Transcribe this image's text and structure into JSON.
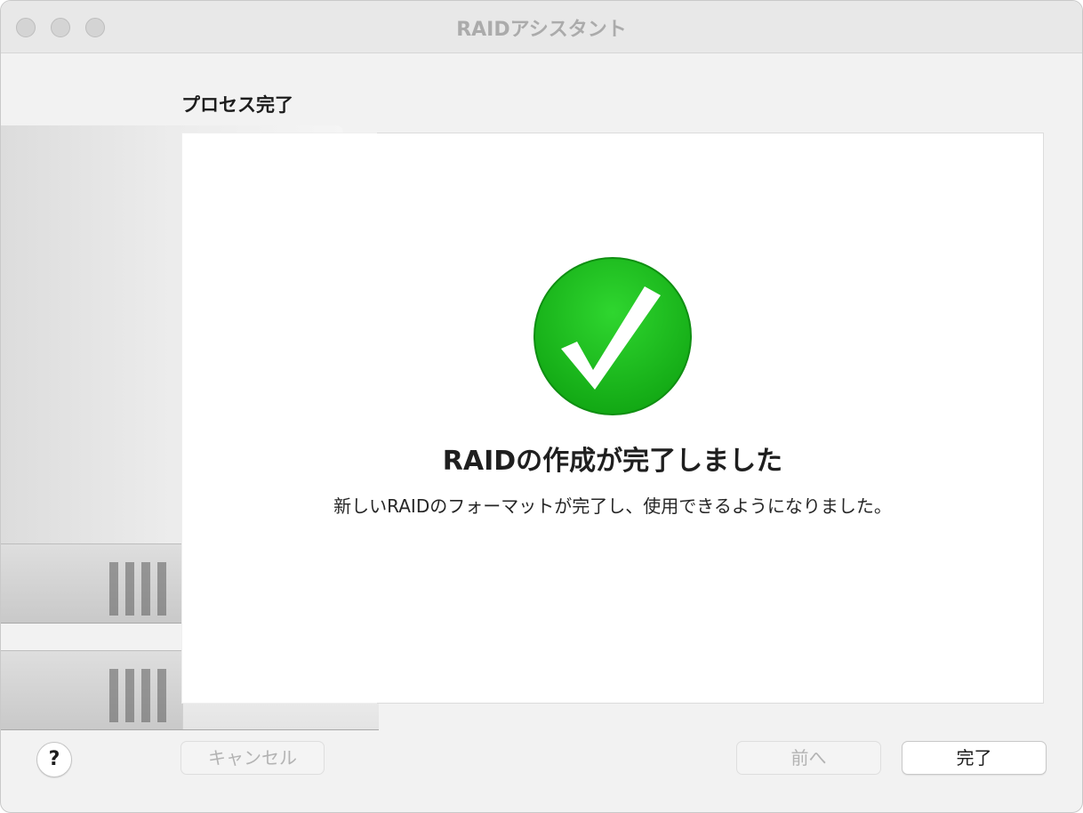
{
  "window": {
    "title": "RAIDアシスタント"
  },
  "section": {
    "label": "プロセス完了"
  },
  "result": {
    "icon": "checkmark-circle-icon",
    "icon_color": "#1ec31f",
    "headline": "RAIDの作成が完了しました",
    "message": "新しいRAIDのフォーマットが完了し、使用できるようになりました。"
  },
  "footer": {
    "help_label": "?",
    "cancel_label": "キャンセル",
    "back_label": "前へ",
    "done_label": "完了"
  }
}
